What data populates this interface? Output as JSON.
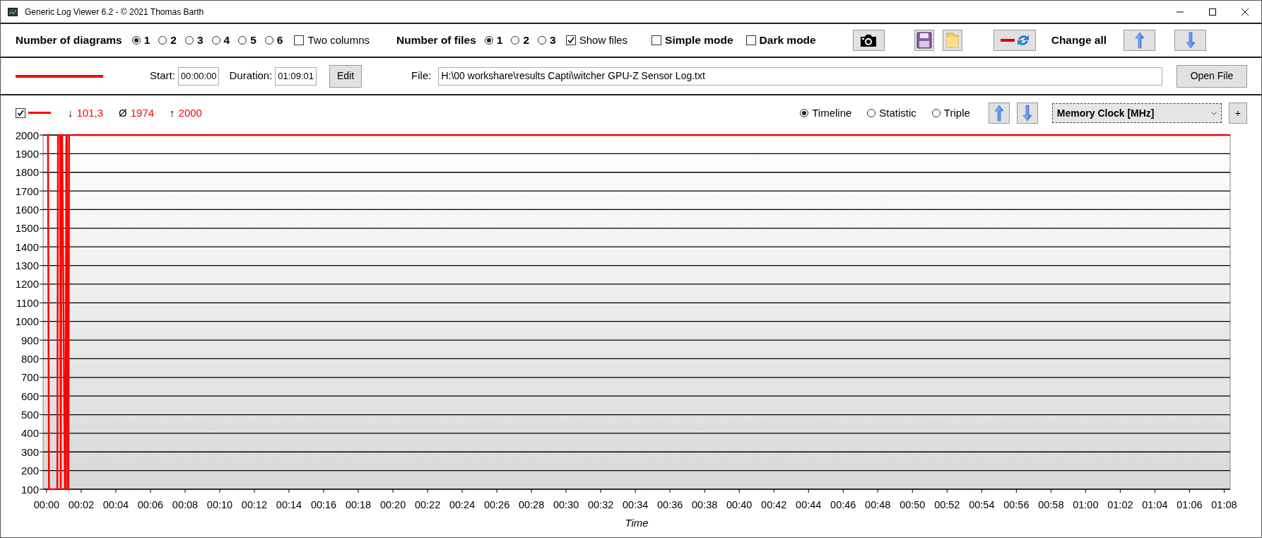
{
  "window": {
    "title": "Generic Log Viewer 6.2 - © 2021 Thomas Barth"
  },
  "toolbar": {
    "diagrams_label": "Number of diagrams",
    "diagram_options": [
      {
        "label": "1",
        "selected": true
      },
      {
        "label": "2",
        "selected": false
      },
      {
        "label": "3",
        "selected": false
      },
      {
        "label": "4",
        "selected": false
      },
      {
        "label": "5",
        "selected": false
      },
      {
        "label": "6",
        "selected": false
      }
    ],
    "two_columns": {
      "label": "Two columns",
      "checked": false
    },
    "files_label": "Number of files",
    "file_options": [
      {
        "label": "1",
        "selected": true
      },
      {
        "label": "2",
        "selected": false
      },
      {
        "label": "3",
        "selected": false
      }
    ],
    "show_files": {
      "label": "Show files",
      "checked": true
    },
    "simple_mode": {
      "label": "Simple mode",
      "checked": false
    },
    "dark_mode": {
      "label": "Dark mode",
      "checked": false
    },
    "change_all_label": "Change all"
  },
  "file_bar": {
    "start_label": "Start:",
    "start_value": "00:00:00",
    "duration_label": "Duration:",
    "duration_value": "01:09:01",
    "edit_button": "Edit",
    "file_label": "File:",
    "file_value": "H:\\00 workshare\\results Capti\\witcher GPU-Z Sensor Log.txt",
    "open_button": "Open File"
  },
  "diagram": {
    "visible": true,
    "stats": [
      {
        "symbol": "↓",
        "value": "101,3"
      },
      {
        "symbol": "Ø",
        "value": "1974"
      },
      {
        "symbol": "↑",
        "value": "2000"
      }
    ],
    "views": [
      {
        "label": "Timeline",
        "selected": true
      },
      {
        "label": "Statistic",
        "selected": false
      },
      {
        "label": "Triple",
        "selected": false
      }
    ],
    "add_button": "+",
    "chart_data": {
      "type": "line",
      "grid": true,
      "xlabel": "Time",
      "xlim": [
        -0.2,
        68.35
      ],
      "ylim": [
        100,
        2000
      ],
      "x": [
        0,
        0.08,
        0.14,
        0.62,
        0.66,
        0.78,
        0.82,
        0.86,
        0.9,
        1.06,
        1.1,
        1.14,
        1.18,
        1.22,
        1.26,
        1.3,
        1.34,
        68.3
      ],
      "series": [
        {
          "name": "Memory Clock [MHz]",
          "color": "#ff0000",
          "values": [
            2000,
            2000,
            100,
            100,
            2000,
            2000,
            100,
            2000,
            2000,
            100,
            100,
            2000,
            2000,
            100,
            100,
            2000,
            2000,
            2000
          ]
        }
      ],
      "yticks": [
        100,
        200,
        300,
        400,
        500,
        600,
        700,
        800,
        900,
        1000,
        1100,
        1200,
        1300,
        1400,
        1500,
        1600,
        1700,
        1800,
        1900,
        2000
      ],
      "xticks": [
        {
          "value": 0,
          "label": "00:00"
        },
        {
          "value": 2,
          "label": "00:02"
        },
        {
          "value": 4,
          "label": "00:04"
        },
        {
          "value": 6,
          "label": "00:06"
        },
        {
          "value": 8,
          "label": "00:08"
        },
        {
          "value": 10,
          "label": "00:10"
        },
        {
          "value": 12,
          "label": "00:12"
        },
        {
          "value": 14,
          "label": "00:14"
        },
        {
          "value": 16,
          "label": "00:16"
        },
        {
          "value": 18,
          "label": "00:18"
        },
        {
          "value": 20,
          "label": "00:20"
        },
        {
          "value": 22,
          "label": "00:22"
        },
        {
          "value": 24,
          "label": "00:24"
        },
        {
          "value": 26,
          "label": "00:26"
        },
        {
          "value": 28,
          "label": "00:28"
        },
        {
          "value": 30,
          "label": "00:30"
        },
        {
          "value": 32,
          "label": "00:32"
        },
        {
          "value": 34,
          "label": "00:34"
        },
        {
          "value": 36,
          "label": "00:36"
        },
        {
          "value": 38,
          "label": "00:38"
        },
        {
          "value": 40,
          "label": "00:40"
        },
        {
          "value": 42,
          "label": "00:42"
        },
        {
          "value": 44,
          "label": "00:44"
        },
        {
          "value": 46,
          "label": "00:46"
        },
        {
          "value": 48,
          "label": "00:48"
        },
        {
          "value": 50,
          "label": "00:50"
        },
        {
          "value": 52,
          "label": "00:52"
        },
        {
          "value": 54,
          "label": "00:54"
        },
        {
          "value": 56,
          "label": "00:56"
        },
        {
          "value": 58,
          "label": "00:58"
        },
        {
          "value": 60,
          "label": "01:00"
        },
        {
          "value": 62,
          "label": "01:02"
        },
        {
          "value": 64,
          "label": "01:04"
        },
        {
          "value": 66,
          "label": "01:06"
        },
        {
          "value": 68,
          "label": "01:08"
        }
      ]
    }
  }
}
